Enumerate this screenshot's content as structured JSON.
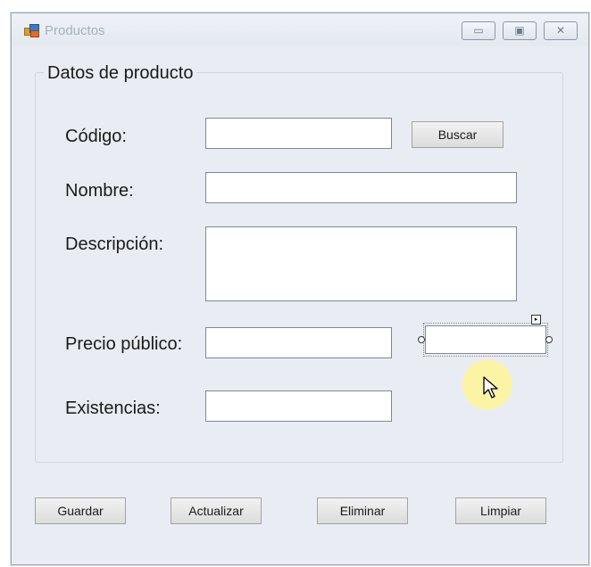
{
  "window": {
    "title": "Productos"
  },
  "window_controls": {
    "minimize_glyph": "▭",
    "maximize_glyph": "▣",
    "close_glyph": "✕"
  },
  "group": {
    "title": "Datos de producto"
  },
  "fields": {
    "codigo": {
      "label": "Código:",
      "value": ""
    },
    "nombre": {
      "label": "Nombre:",
      "value": ""
    },
    "descripcion": {
      "label": "Descripción:",
      "value": ""
    },
    "precio": {
      "label": "Precio público:",
      "value": ""
    },
    "existencias": {
      "label": "Existencias:",
      "value": ""
    }
  },
  "buttons": {
    "buscar": "Buscar",
    "guardar": "Guardar",
    "actualizar": "Actualizar",
    "eliminar": "Eliminar",
    "limpiar": "Limpiar"
  },
  "designer": {
    "smart_tag_glyph": "▸"
  },
  "colors": {
    "window_bg": "#e9edf3",
    "title_text": "#a6b0bd",
    "cursor_highlight": "#fff596"
  }
}
